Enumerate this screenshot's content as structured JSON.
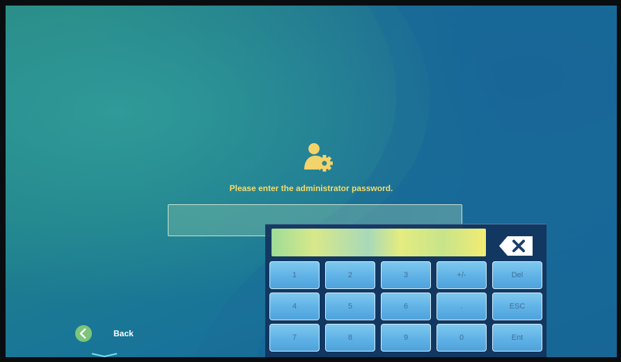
{
  "prompt": "Please enter the administrator password.",
  "password_field": {
    "value": ""
  },
  "keypad": {
    "display_value": "",
    "keys": [
      "1",
      "2",
      "3",
      "+/-",
      "Del",
      "4",
      "5",
      "6",
      ".",
      "ESC",
      "7",
      "8",
      "9",
      "0",
      "Ent"
    ]
  },
  "back": {
    "label": "Back"
  },
  "icons": {
    "admin": "admin-settings-icon",
    "backspace": "backspace-icon",
    "back": "chevron-left-icon"
  },
  "colors": {
    "prompt_text": "#f4dc6e",
    "admin_icon": "#f4d36a",
    "key_face": "#5fb2e6",
    "keyboard_panel": "#12345c",
    "back_circle": "#7cc57a"
  }
}
